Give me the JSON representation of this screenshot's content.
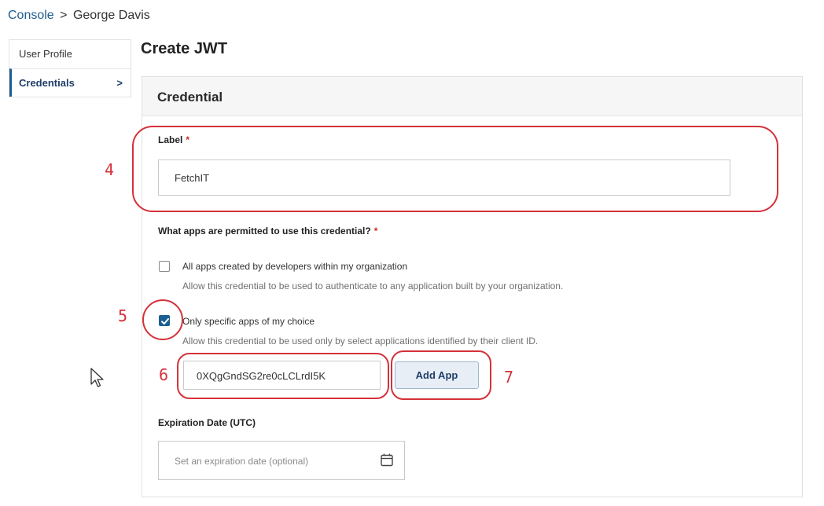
{
  "breadcrumb": {
    "root": "Console",
    "separator": ">",
    "current": "George Davis"
  },
  "sidebar": {
    "items": [
      {
        "label": "User Profile",
        "active": false
      },
      {
        "label": "Credentials",
        "active": true,
        "chevron": ">"
      }
    ]
  },
  "page": {
    "title": "Create JWT"
  },
  "card": {
    "title": "Credential",
    "label_field": {
      "label": "Label",
      "required_mark": "*",
      "value": "FetchIT"
    },
    "apps": {
      "question": "What apps are permitted to use this credential?",
      "required_mark": "*",
      "options": [
        {
          "title": "All apps created by developers within my organization",
          "description": "Allow this credential to be used to authenticate to any application built by your organization.",
          "checked": false
        },
        {
          "title": "Only specific apps of my choice",
          "description": "Allow this credential to be used only by select applications identified by their client ID.",
          "checked": true
        }
      ],
      "client_id_value": "0XQgGndSG2re0cLCLrdI5K",
      "add_button_label": "Add App"
    },
    "expiration": {
      "label": "Expiration Date (UTC)",
      "placeholder": "Set an expiration date (optional)",
      "icon": "calendar-icon"
    }
  },
  "annotations": [
    "4",
    "5",
    "6",
    "7"
  ],
  "colors": {
    "accent": "#1f5c8f",
    "annotation": "#d5313a",
    "required": "#d0271d",
    "checkbox": "#1b5e92"
  }
}
